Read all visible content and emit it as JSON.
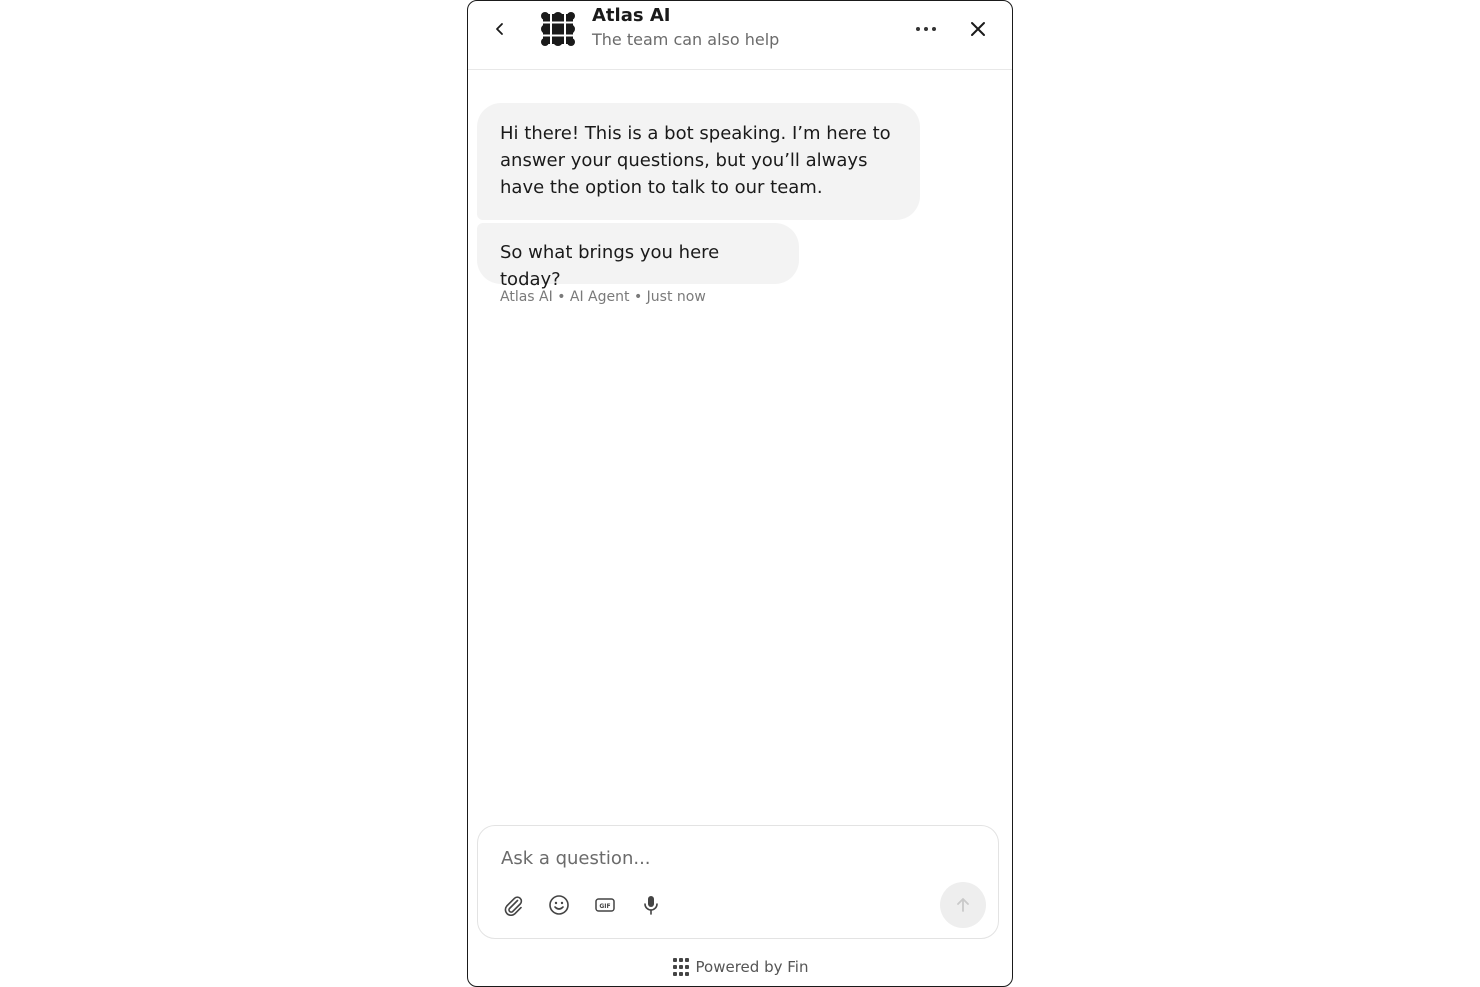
{
  "header": {
    "title": "Atlas AI",
    "subtitle": "The team can also help",
    "back_icon": "chevron-left-icon",
    "logo_icon": "atlas-logo-icon",
    "more_icon": "more-horizontal-icon",
    "close_icon": "close-icon"
  },
  "messages": [
    {
      "text": "Hi there! This is a bot speaking. I’m here to answer your questions, but you’ll always have the option to talk to our team."
    },
    {
      "text": "So what brings you here today?"
    }
  ],
  "meta": "Atlas AI • AI Agent • Just now",
  "composer": {
    "placeholder": "Ask a question...",
    "value": "",
    "tools": [
      "paperclip-icon",
      "emoji-icon",
      "gif-icon",
      "microphone-icon"
    ],
    "send_icon": "arrow-up-icon"
  },
  "footer": {
    "label": "Powered by Fin",
    "icon": "fin-logo-icon"
  },
  "colors": {
    "bubble": "#f3f3f3",
    "text": "#1a1a1a",
    "muted": "#6b6b6b",
    "border": "#1a1a1a",
    "send_disabled": "#eeeeee"
  }
}
